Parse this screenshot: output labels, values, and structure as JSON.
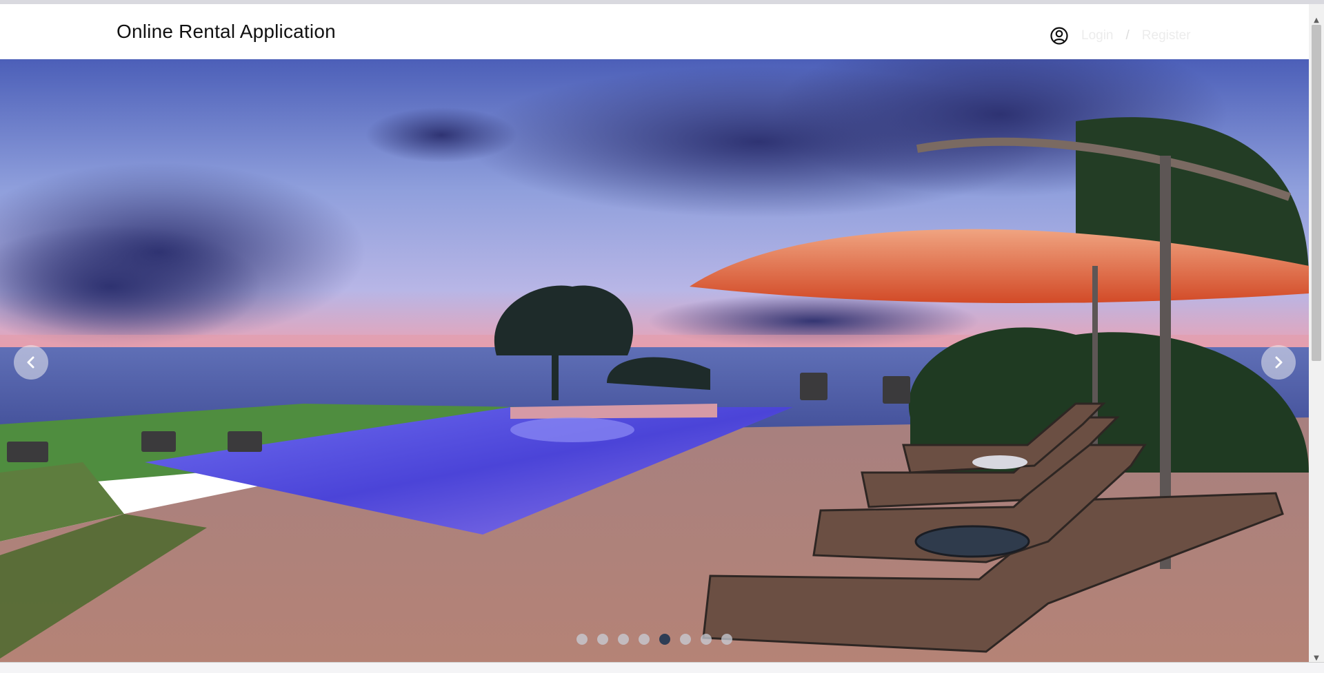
{
  "header": {
    "title": "Online Rental Application",
    "login_label": "Login",
    "separator": "/",
    "register_label": "Register",
    "user_icon": "user-circle-icon"
  },
  "carousel": {
    "prev_icon": "chevron-left-icon",
    "next_icon": "chevron-right-icon",
    "slide_count": 8,
    "active_index": 4,
    "image_description": "resort infinity pool at dusk with ocean view, lounge chairs and orange umbrella"
  },
  "colors": {
    "active_dot": "#2e3d55",
    "inactive_dot": "#c8cdd7"
  }
}
